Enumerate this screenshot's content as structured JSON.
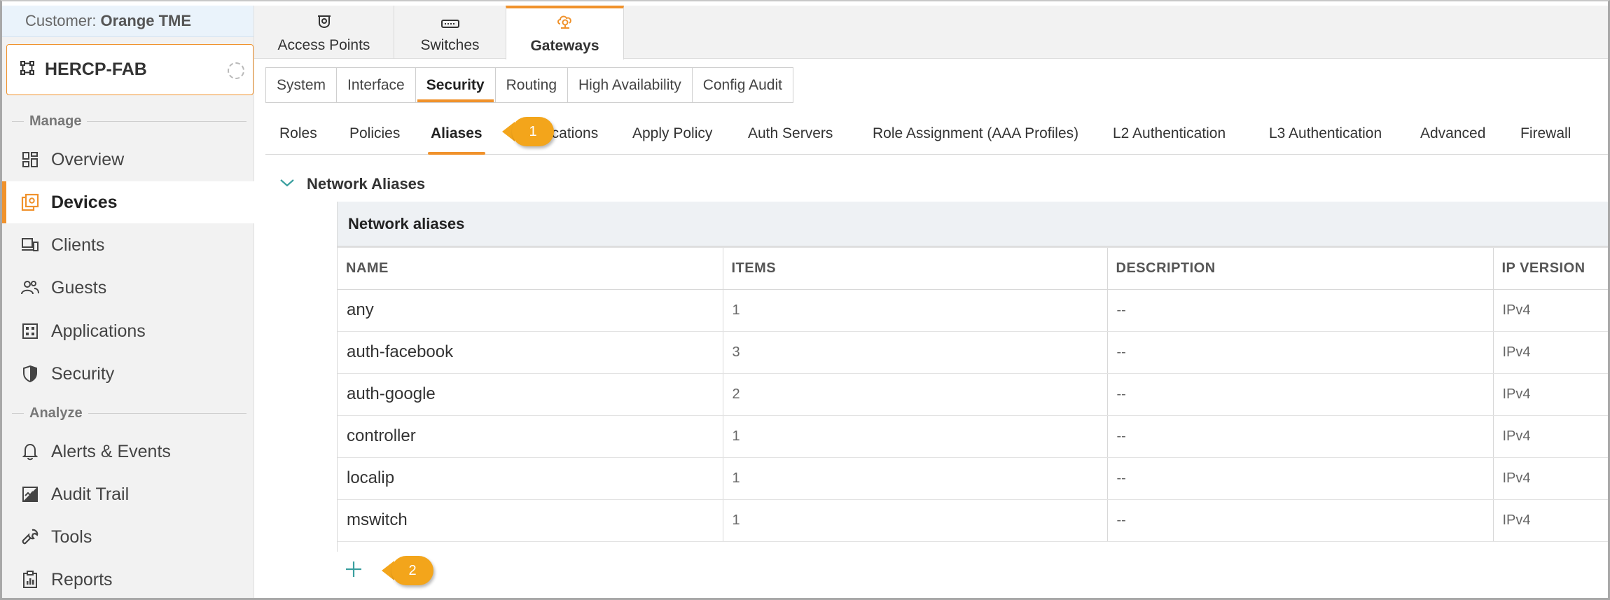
{
  "customer": {
    "label": "Customer:",
    "name": "Orange TME"
  },
  "site": {
    "name": "HERCP-FAB",
    "icon": "site-group-icon"
  },
  "sidebar": {
    "sections": [
      {
        "label": "Manage"
      },
      {
        "label": "Analyze"
      }
    ],
    "items": [
      {
        "label": "Overview",
        "icon": "grid-icon"
      },
      {
        "label": "Devices",
        "icon": "devices-icon",
        "active": true
      },
      {
        "label": "Clients",
        "icon": "clients-icon"
      },
      {
        "label": "Guests",
        "icon": "guests-icon"
      },
      {
        "label": "Applications",
        "icon": "applications-icon"
      },
      {
        "label": "Security",
        "icon": "shield-icon"
      },
      {
        "label": "Alerts & Events",
        "icon": "bell-icon"
      },
      {
        "label": "Audit Trail",
        "icon": "audit-icon"
      },
      {
        "label": "Tools",
        "icon": "wrench-icon"
      },
      {
        "label": "Reports",
        "icon": "reports-icon"
      }
    ]
  },
  "device_tabs": [
    {
      "label": "Access Points",
      "icon": "access-point-icon"
    },
    {
      "label": "Switches",
      "icon": "switch-icon"
    },
    {
      "label": "Gateways",
      "icon": "gateway-icon",
      "active": true
    }
  ],
  "config_tabs": [
    "System",
    "Interface",
    "Security",
    "Routing",
    "High Availability",
    "Config Audit"
  ],
  "security_tabs": [
    "Roles",
    "Policies",
    "Aliases",
    "Applications",
    "Apply Policy",
    "Auth Servers",
    "Role Assignment (AAA Profiles)",
    "L2 Authentication",
    "L3 Authentication",
    "Advanced",
    "Firewall"
  ],
  "security_tabs_visible": {
    "applications": "ications"
  },
  "aliases": {
    "section_title": "Network Aliases",
    "table_title": "Network aliases",
    "columns": [
      "NAME",
      "ITEMS",
      "DESCRIPTION",
      "IP VERSION"
    ],
    "rows": [
      {
        "name": "any",
        "items": "1",
        "description": "--",
        "ip_version": "IPv4"
      },
      {
        "name": "auth-facebook",
        "items": "3",
        "description": "--",
        "ip_version": "IPv4"
      },
      {
        "name": "auth-google",
        "items": "2",
        "description": "--",
        "ip_version": "IPv4"
      },
      {
        "name": "controller",
        "items": "1",
        "description": "--",
        "ip_version": "IPv4"
      },
      {
        "name": "localip",
        "items": "1",
        "description": "--",
        "ip_version": "IPv4"
      },
      {
        "name": "mswitch",
        "items": "1",
        "description": "--",
        "ip_version": "IPv4"
      }
    ]
  },
  "callouts": [
    "1",
    "2"
  ],
  "colors": {
    "accent": "#f0922c",
    "callout": "#f3a51b",
    "teal": "#3a9f9f"
  }
}
